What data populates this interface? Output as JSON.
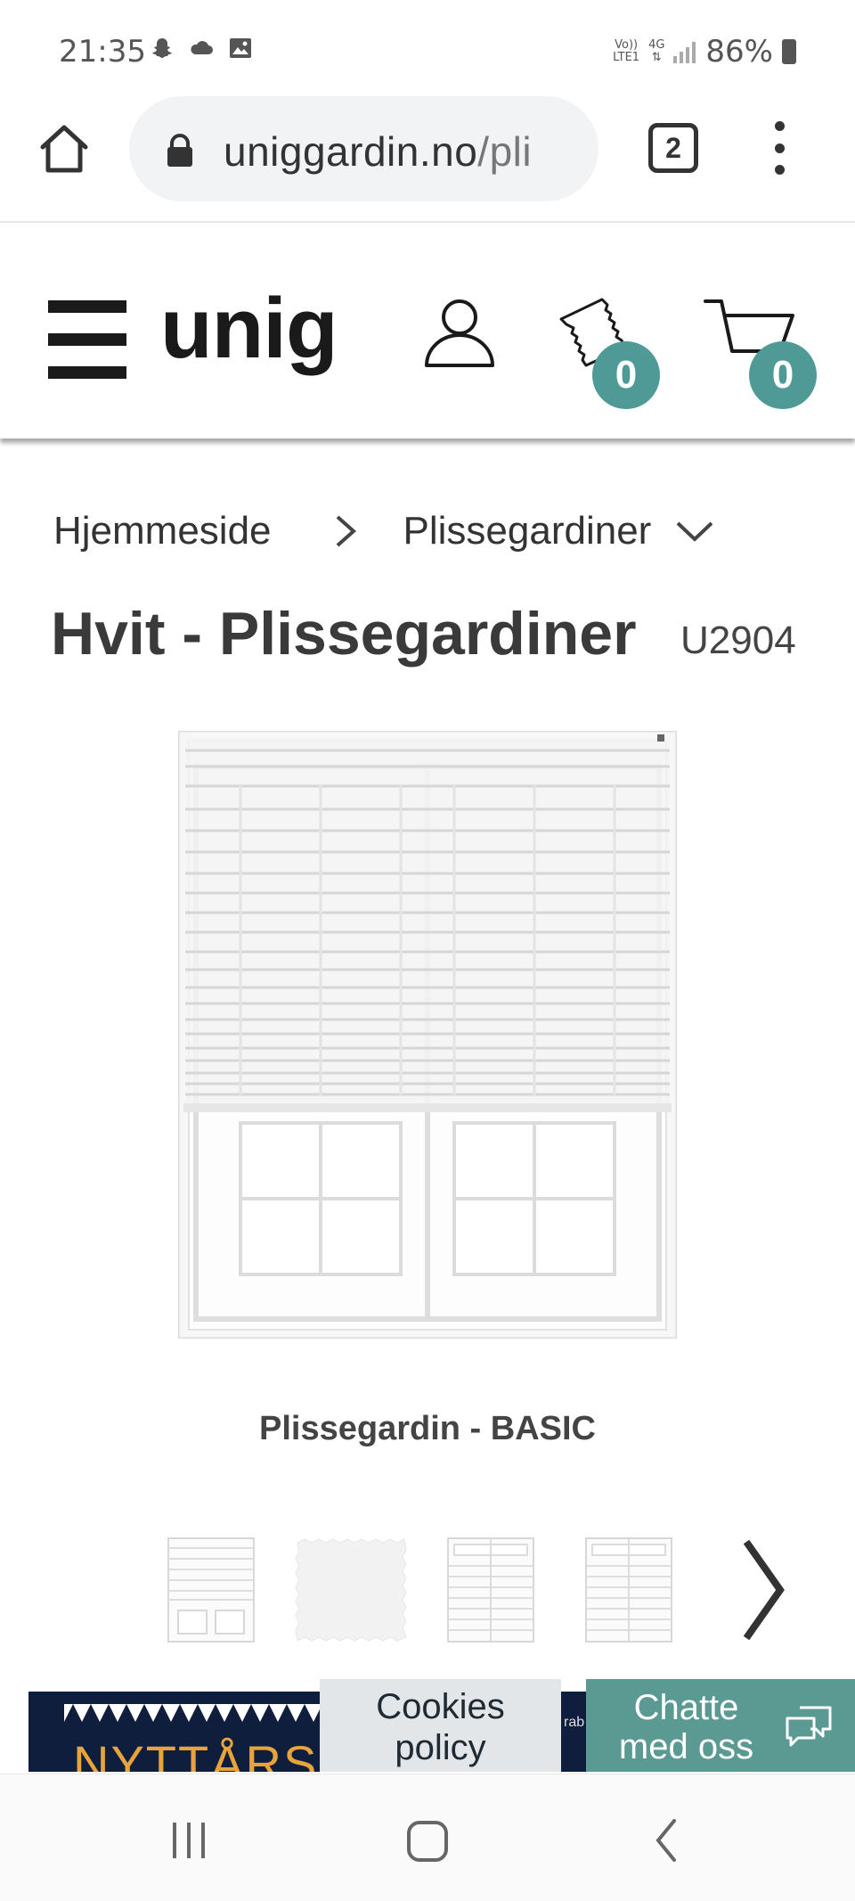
{
  "status_bar": {
    "time": "21:35",
    "network_top": "Vo))",
    "network_bottom": "LTE1",
    "network_type": "4G",
    "battery": "86%"
  },
  "browser": {
    "url_main": "uniggardin.no",
    "url_path": "/pli",
    "tab_count": "2"
  },
  "header": {
    "logo": "unig",
    "samples_count": "0",
    "cart_count": "0"
  },
  "breadcrumb": {
    "home": "Hjemmeside",
    "category": "Plissegardiner"
  },
  "product": {
    "title": "Hvit - Plissegardiner",
    "code": "U2904",
    "caption": "Plissegardin - BASIC"
  },
  "promo": {
    "text": "NYTTÅRS S",
    "strip_text": "rab"
  },
  "buttons": {
    "cookies_line1": "Cookies",
    "cookies_line2": "policy",
    "chat_line1": "Chatte",
    "chat_line2": "med oss"
  },
  "colors": {
    "accent": "#4f9a96",
    "chat": "#5a9a93",
    "promo_bg": "#0f1e3d",
    "promo_text": "#e8a33a"
  }
}
